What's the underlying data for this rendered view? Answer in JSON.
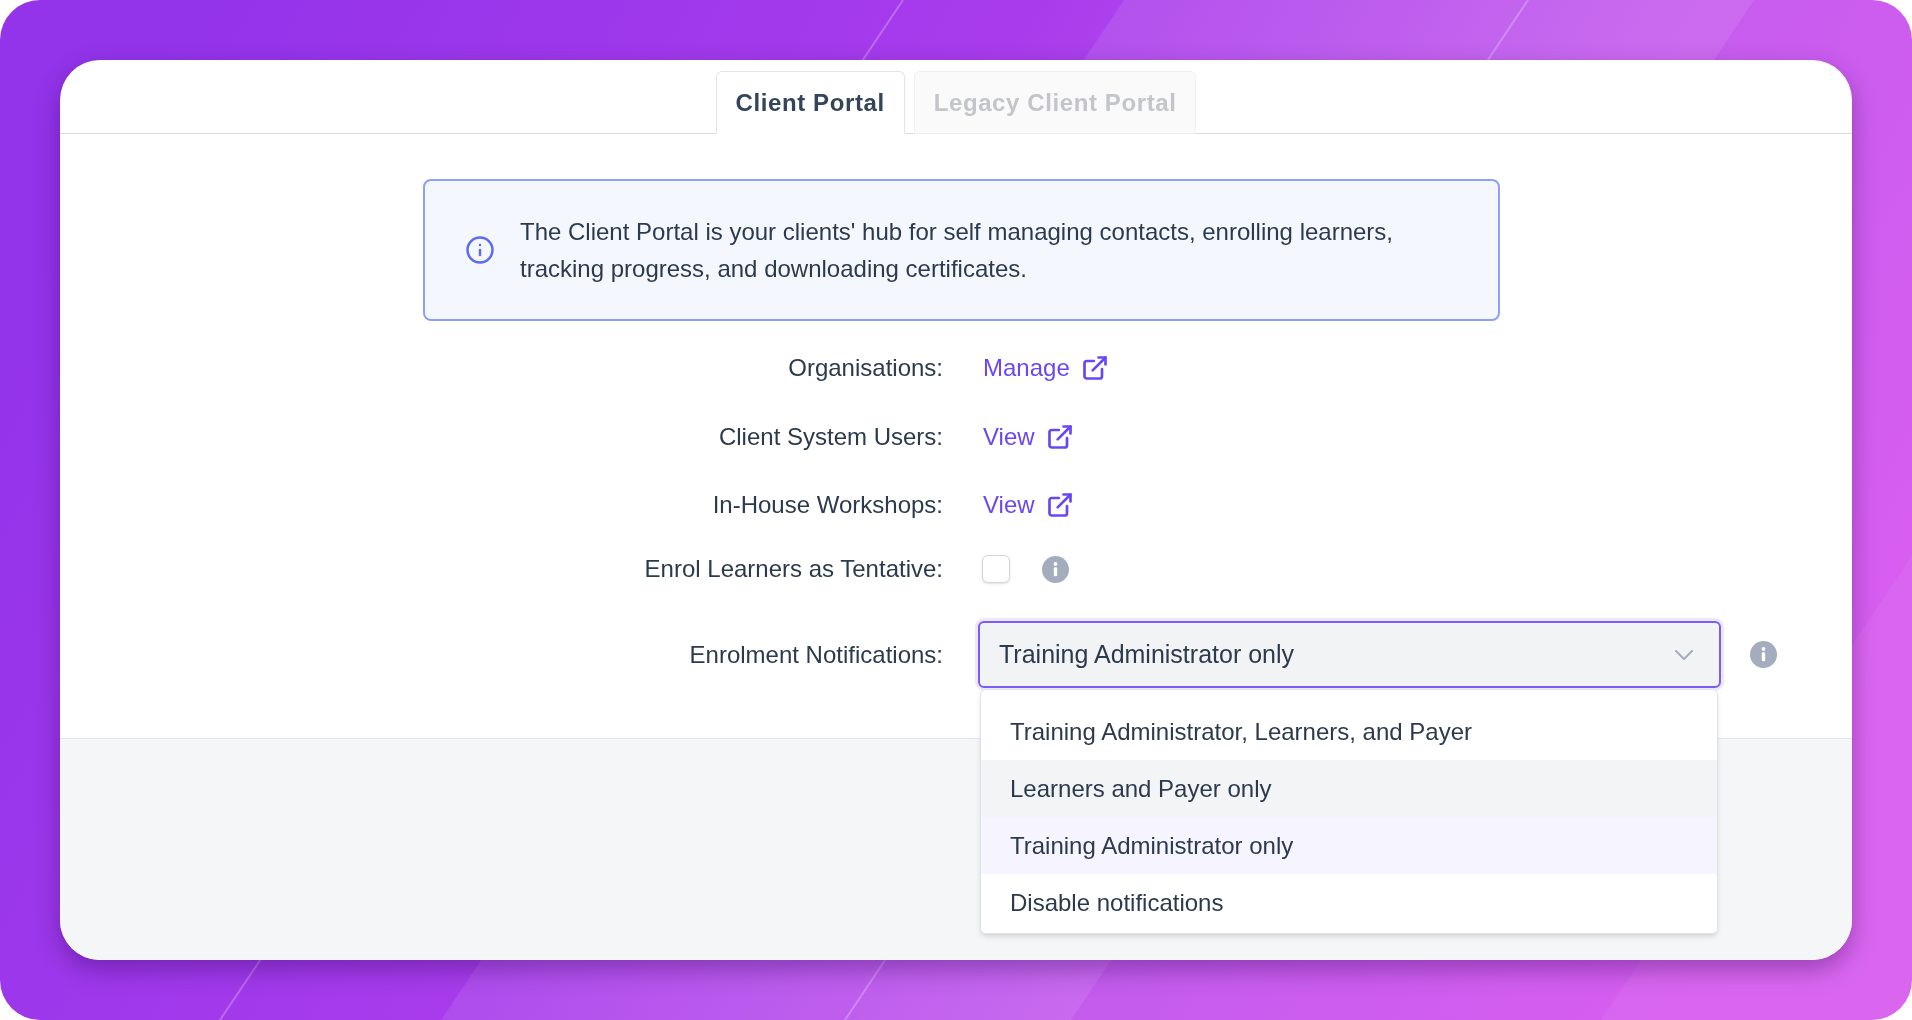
{
  "tabs": [
    {
      "label": "Client Portal",
      "selected": true
    },
    {
      "label": "Legacy Client Portal",
      "selected": false
    }
  ],
  "info_banner": {
    "text": "The Client Portal is your clients' hub for self managing contacts, enrolling learners, tracking progress, and downloading certificates."
  },
  "settings": [
    {
      "kind": "link",
      "label": "Organisations:",
      "link": "Manage"
    },
    {
      "kind": "link",
      "label": "Client System Users:",
      "link": "View"
    },
    {
      "kind": "link",
      "label": "In-House Workshops:",
      "link": "View"
    },
    {
      "kind": "checkbox",
      "label": "Enrol Learners as Tentative:",
      "checked": false
    },
    {
      "kind": "select",
      "label": "Enrolment Notifications:",
      "value": "Training Administrator only",
      "expanded": true,
      "options": [
        {
          "label": "Training Administrator, Learners, and Payer",
          "selected": false,
          "highlighted": false
        },
        {
          "label": "Learners and Payer only",
          "selected": false,
          "highlighted": true
        },
        {
          "label": "Training Administrator only",
          "selected": true,
          "highlighted": false
        },
        {
          "label": "Disable notifications",
          "selected": false,
          "highlighted": false
        }
      ]
    }
  ]
}
